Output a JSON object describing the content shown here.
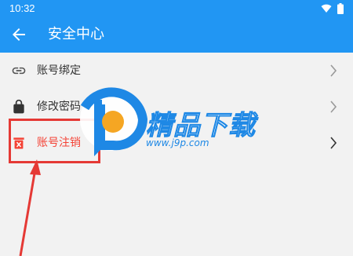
{
  "status_bar": {
    "time": "10:32"
  },
  "app_bar": {
    "title": "安全中心"
  },
  "menu": {
    "items": [
      {
        "label": "账号绑定",
        "icon": "link-icon"
      },
      {
        "label": "修改密码",
        "icon": "lock-icon"
      },
      {
        "label": "账号注销",
        "icon": "delete-account-icon"
      }
    ]
  },
  "watermark": {
    "text": "精品下载",
    "url": "www.j9p.com"
  },
  "colors": {
    "primary": "#2196f3",
    "danger": "#f44336",
    "annotation": "#e53935",
    "background": "#f2f2f2"
  }
}
